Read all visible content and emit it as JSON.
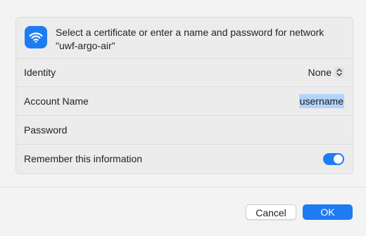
{
  "dialog": {
    "message": "Select a certificate or enter a name and password for network \"uwf-argo-air\"",
    "icon": "wifi-icon"
  },
  "form": {
    "identity": {
      "label": "Identity",
      "value": "None"
    },
    "account_name": {
      "label": "Account Name",
      "value": "username"
    },
    "password": {
      "label": "Password",
      "value": ""
    },
    "remember": {
      "label": "Remember this information",
      "checked": true
    }
  },
  "buttons": {
    "cancel": "Cancel",
    "ok": "OK"
  },
  "colors": {
    "accent": "#1e7cf2",
    "selection": "#b2d4fb"
  }
}
